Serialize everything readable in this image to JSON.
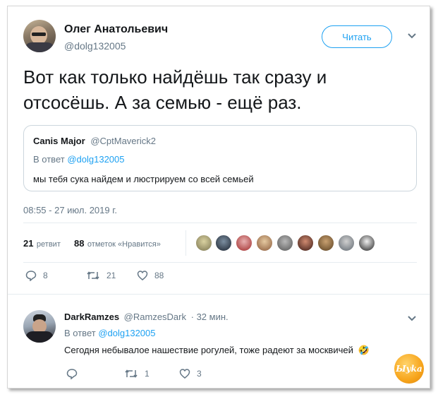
{
  "tweet": {
    "author_name": "Олег Анатольевич",
    "author_handle": "@dolg132005",
    "follow_label": "Читать",
    "text_line1": "Вот как только найдёшь так сразу и",
    "text_line2": "отсосёшь. А за семью - ещё раз.",
    "timestamp": "08:55 - 27 июл. 2019 г.",
    "retweets_count": "21",
    "retweets_label": "ретвит",
    "likes_count": "88",
    "likes_label": "отметок «Нравится»",
    "actions": {
      "reply": "8",
      "retweet": "21",
      "like": "88"
    }
  },
  "quote": {
    "author_name": "Canis Major",
    "author_handle": "@CptMaverick2",
    "reply_prefix": "В ответ",
    "reply_to": "@dolg132005",
    "text": "мы тебя сука найдем и люстрируем со всей семьей"
  },
  "reply": {
    "author_name": "DarkRamzes",
    "author_handle": "@RamzesDark",
    "time": "· 32 мин.",
    "reply_prefix": "В ответ",
    "reply_to": "@dolg132005",
    "text": "Сегодня небывалое нашествие рогулей, тоже радеют за москвичей",
    "emoji": "🤣",
    "actions": {
      "reply": "",
      "retweet": "1",
      "like": "3"
    }
  },
  "watermark": {
    "text": "Ыyka"
  },
  "icons": {
    "chevron": "chevron-down-icon",
    "reply": "reply-icon",
    "retweet": "retweet-icon",
    "like": "heart-icon"
  },
  "colors": {
    "accent": "#1da1f2",
    "muted": "#657786",
    "border": "#ccd6dd",
    "watermark": "#f7a51c"
  }
}
